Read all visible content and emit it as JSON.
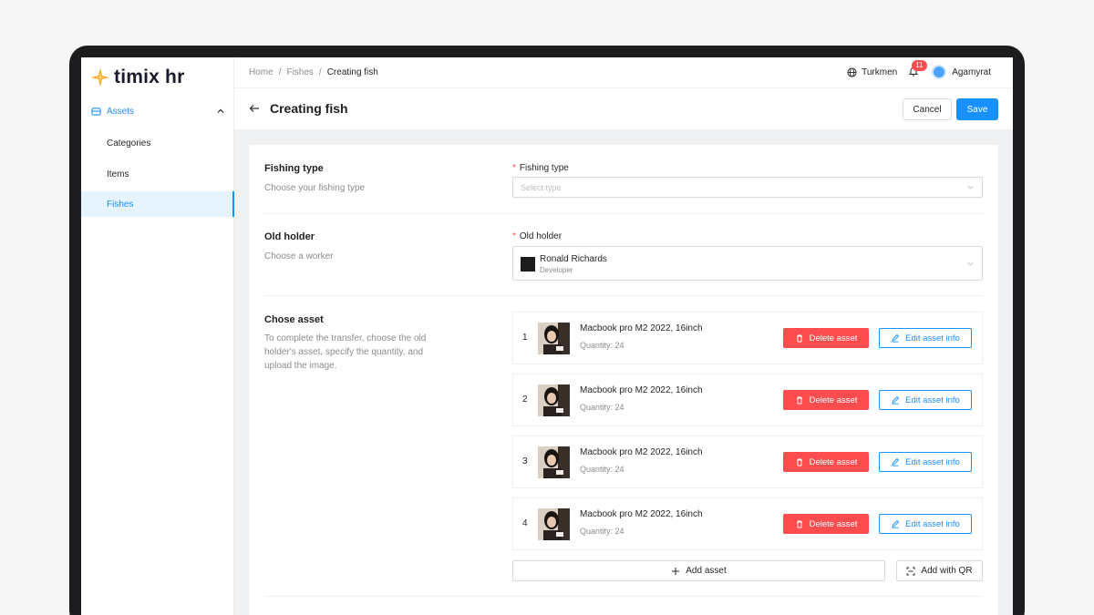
{
  "app": {
    "logo_text": "timix hr",
    "accent": "#1890ff",
    "danger": "#ff4d4f"
  },
  "sidebar": {
    "group_label": "Assets",
    "items": [
      {
        "label": "Categories",
        "active": false
      },
      {
        "label": "Items",
        "active": false
      },
      {
        "label": "Fishes",
        "active": true
      }
    ]
  },
  "topbar": {
    "breadcrumb": [
      "Home",
      "Fishes",
      "Creating fish"
    ],
    "separator": "/",
    "language": "Turkmen",
    "notifications_count": "11",
    "user_name": "Agamyrat"
  },
  "header": {
    "title": "Creating fish",
    "cancel_label": "Cancel",
    "save_label": "Save"
  },
  "sections": {
    "fishing_type": {
      "title": "Fishing type",
      "description": "Choose your fishing type",
      "field_label": "Fishing type",
      "placeholder": "Select type"
    },
    "old_holder": {
      "title": "Old holder",
      "description": "Choose a worker",
      "field_label": "Old holder",
      "selected_name": "Ronald Richards",
      "selected_role": "Developer"
    },
    "chose_asset": {
      "title": "Chose asset",
      "description": "To complete the transfer, choose the old holder's asset, specify the quantity, and upload the image.",
      "assets": [
        {
          "num": "1",
          "name": "Macbook pro M2 2022, 16inch",
          "qty": "Quantity: 24",
          "delete_label": "Delete asset",
          "edit_label": "Edit asset info"
        },
        {
          "num": "2",
          "name": "Macbook pro M2 2022, 16inch",
          "qty": "Quantity: 24",
          "delete_label": "Delete asset",
          "edit_label": "Edit asset info"
        },
        {
          "num": "3",
          "name": "Macbook pro M2 2022, 16inch",
          "qty": "Quantity: 24",
          "delete_label": "Delete asset",
          "edit_label": "Edit asset info"
        },
        {
          "num": "4",
          "name": "Macbook pro M2 2022, 16inch",
          "qty": "Quantity: 24",
          "delete_label": "Delete asset",
          "edit_label": "Edit asset info"
        }
      ],
      "add_asset_label": "Add asset",
      "add_qr_label": "Add with QR"
    }
  }
}
